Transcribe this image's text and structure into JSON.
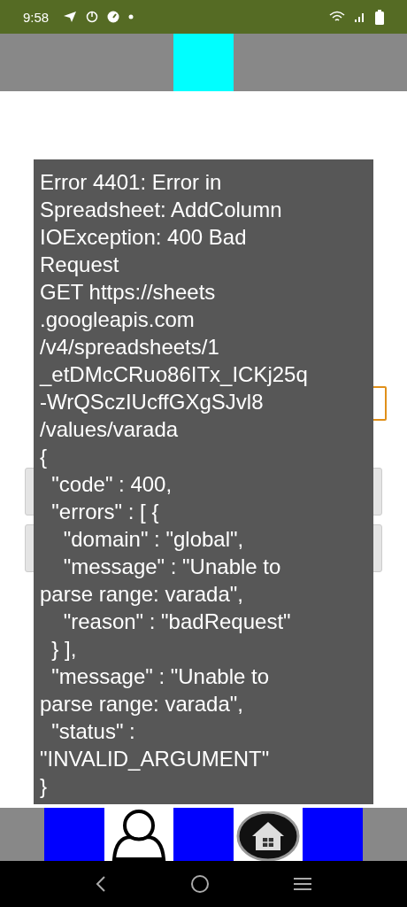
{
  "status_bar": {
    "time": "9:58"
  },
  "page": {
    "buttons": [
      {
        "kind": "button"
      },
      {
        "kind": "button"
      }
    ]
  },
  "toast": {
    "lines": [
      "Error 4401: Error in",
      "Spreadsheet: AddColumn",
      "IOException: 400 Bad",
      "Request",
      "GET https://sheets",
      ".googleapis.com",
      "/v4/spreadsheets/1",
      "_etDMcCRuo86ITx_ICKj25q",
      "-WrQSczIUcffGXgSJvl8",
      "/values/varada",
      "{",
      "  \"code\" : 400,",
      "  \"errors\" : [ {",
      "    \"domain\" : \"global\",",
      "    \"message\" : \"Unable to",
      "parse range: varada\",",
      "    \"reason\" : \"badRequest\"",
      "  } ],",
      "  \"message\" : \"Unable to",
      "parse range: varada\",",
      "  \"status\" :",
      "\"INVALID_ARGUMENT\"",
      "}"
    ]
  }
}
